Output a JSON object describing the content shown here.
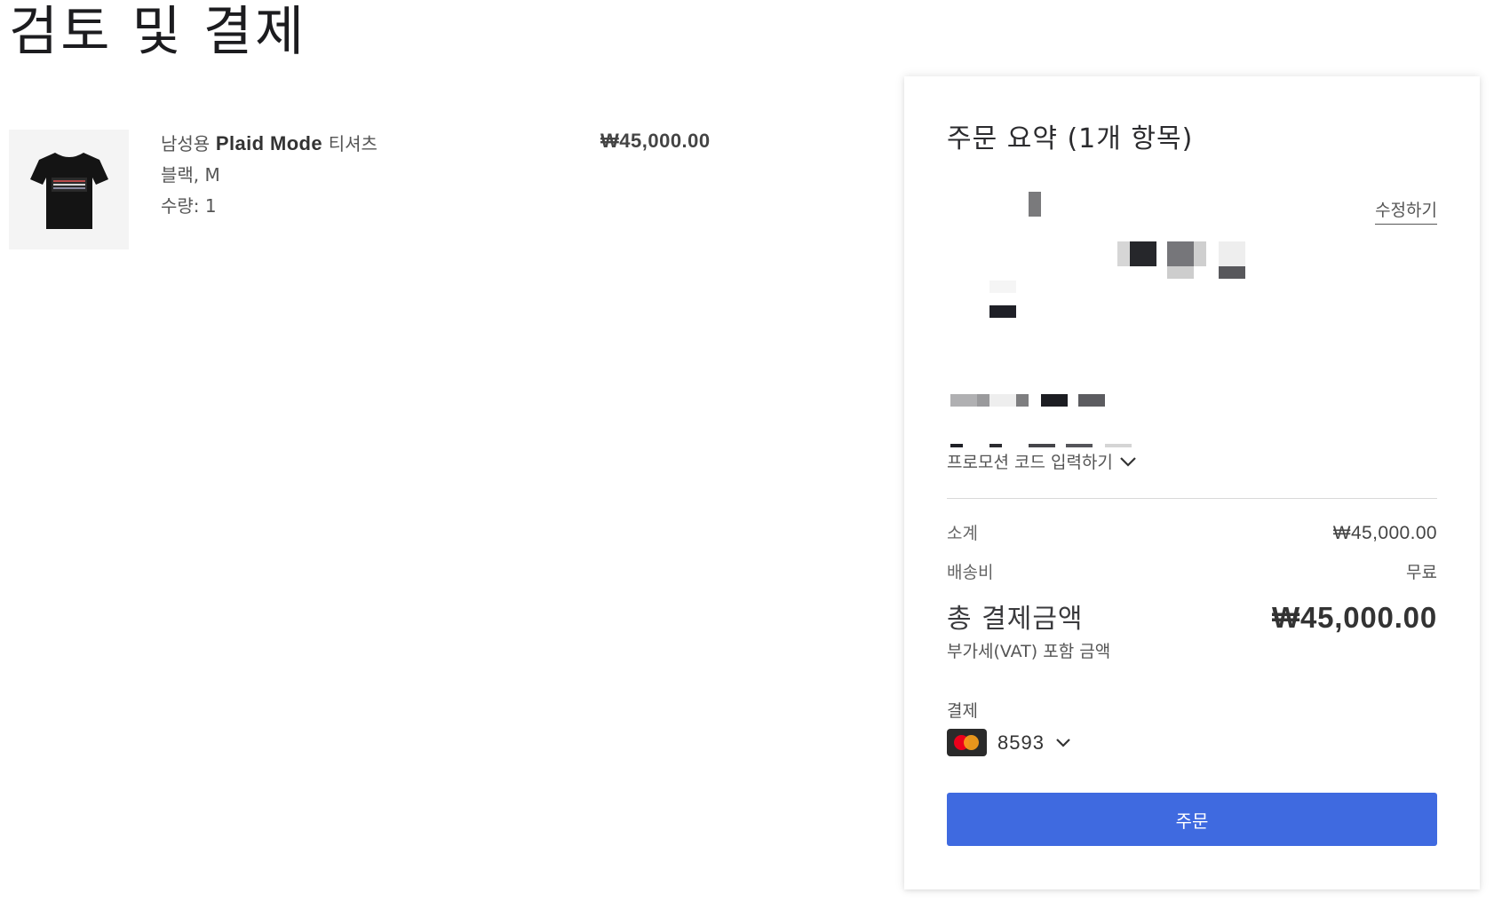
{
  "page": {
    "title": "검토 및 결제"
  },
  "product": {
    "name_prefix": "남성용",
    "name_main": "Plaid Mode",
    "name_suffix": "티셔츠",
    "variant": "블랙, M",
    "quantity_label": "수량: 1",
    "price": "₩45,000.00",
    "image": "black-tshirt-image"
  },
  "summary": {
    "title": "주문 요약 (1개 항목)",
    "edit_label": "수정하기",
    "promo_label": "프로모션 코드 입력하기",
    "subtotal_label": "소계",
    "subtotal_value": "₩45,000.00",
    "shipping_label": "배송비",
    "shipping_value": "무료",
    "total_label": "총 결제금액",
    "total_value": "₩45,000.00",
    "vat_note": "부가세(VAT) 포함 금액",
    "payment_label": "결제",
    "card_last4": "8593",
    "card_brand": "mastercard-icon",
    "order_button": "주문"
  },
  "colors": {
    "accent": "#3f6ae0",
    "text": "#1f1f23"
  }
}
